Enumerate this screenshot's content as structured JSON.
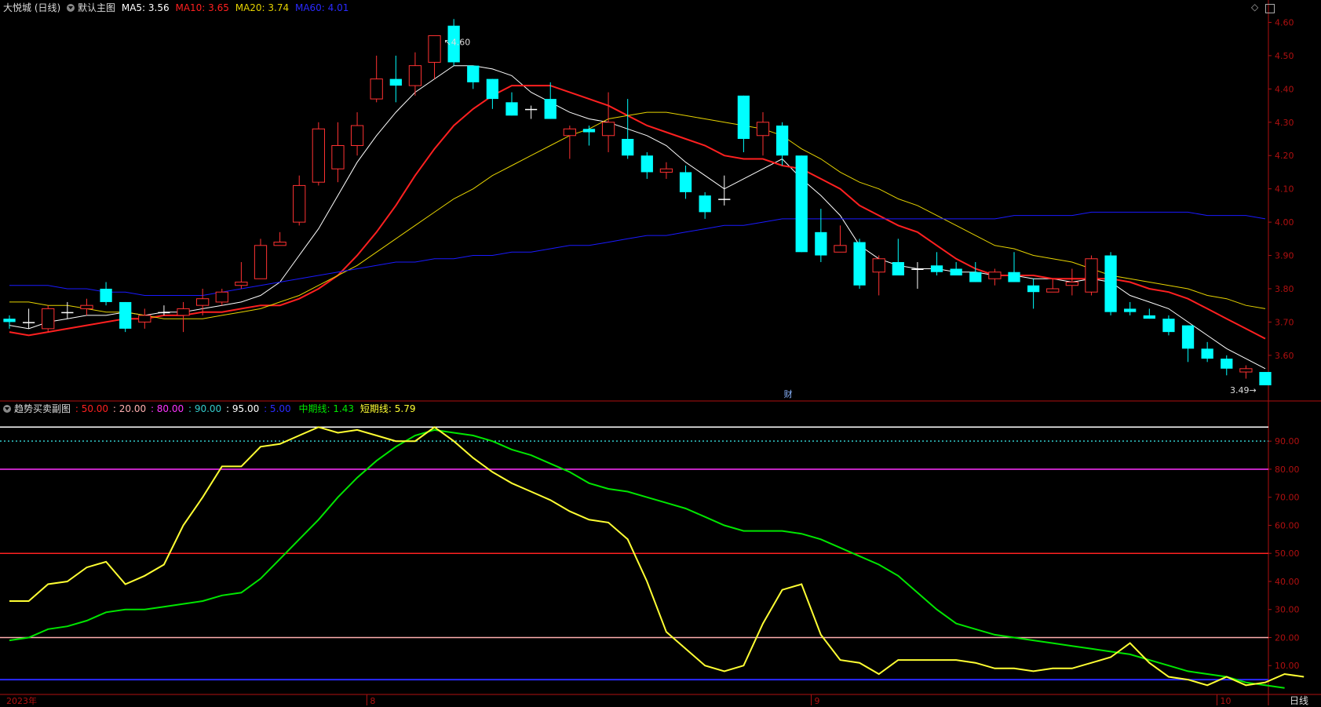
{
  "header": {
    "stock_name": "大悦城 (日线)",
    "main_chart_label": "默认主图",
    "ma5": "MA5: 3.56",
    "ma10": "MA10: 3.65",
    "ma20": "MA20: 3.74",
    "ma60": "MA60: 4.01"
  },
  "sub_header": {
    "title": "趋势买卖副图",
    "levels": [
      ": 50.00",
      ": 20.00",
      ": 80.00",
      ": 90.00",
      ": 95.00",
      ": 5.00"
    ],
    "mid_line": "中期线: 1.43",
    "short_line": "短期线: 5.79"
  },
  "colors": {
    "up": "#ff3232",
    "down": "#00ffff",
    "ma5": "#ffffff",
    "ma10": "#ff2020",
    "ma20": "#e6d300",
    "ma60": "#1a1aff",
    "mid": "#00e600",
    "short": "#ffff33",
    "l50": "#ff2020",
    "l20": "#ffb0b0",
    "l80": "#ff33ff",
    "l90": "#33cccc",
    "l95": "#ffffff",
    "l5": "#2a2aff",
    "axis": "#b01010"
  },
  "bottom_bar": {
    "period_label": "日线"
  },
  "corner_icons": [
    "diamond-icon",
    "fullscreen-icon"
  ],
  "chart_data": [
    {
      "type": "candlestick",
      "title": "默认主图",
      "ylim": [
        3.47,
        4.62
      ],
      "y_ticks": [
        "4.60",
        "4.50",
        "4.40",
        "4.30",
        "4.20",
        "4.10",
        "4.00",
        "3.90",
        "3.80",
        "3.70",
        "3.60"
      ],
      "x_labels": [
        {
          "index": 0,
          "label": "2023年"
        },
        {
          "index": 19,
          "label": "8"
        },
        {
          "index": 42,
          "label": "9"
        },
        {
          "index": 63,
          "label": "10"
        }
      ],
      "annotations": {
        "high_label": "4.60",
        "high_index": 22,
        "low_label": "3.49",
        "low_index": 65,
        "event_label": "财",
        "event_index": 40
      },
      "ohlc": [
        [
          3.71,
          3.72,
          3.68,
          3.7
        ],
        [
          3.7,
          3.74,
          3.68,
          3.7
        ],
        [
          3.68,
          3.75,
          3.67,
          3.74
        ],
        [
          3.73,
          3.76,
          3.71,
          3.73
        ],
        [
          3.74,
          3.77,
          3.72,
          3.75
        ],
        [
          3.8,
          3.82,
          3.75,
          3.76
        ],
        [
          3.76,
          3.76,
          3.67,
          3.68
        ],
        [
          3.7,
          3.74,
          3.68,
          3.72
        ],
        [
          3.73,
          3.75,
          3.72,
          3.73
        ],
        [
          3.72,
          3.76,
          3.67,
          3.74
        ],
        [
          3.75,
          3.8,
          3.72,
          3.77
        ],
        [
          3.76,
          3.8,
          3.75,
          3.79
        ],
        [
          3.81,
          3.88,
          3.8,
          3.82
        ],
        [
          3.83,
          3.95,
          3.83,
          3.93
        ],
        [
          3.93,
          3.97,
          3.93,
          3.94
        ],
        [
          4.0,
          4.14,
          3.99,
          4.11
        ],
        [
          4.12,
          4.3,
          4.11,
          4.28
        ],
        [
          4.16,
          4.3,
          4.12,
          4.23
        ],
        [
          4.23,
          4.33,
          4.2,
          4.29
        ],
        [
          4.37,
          4.5,
          4.36,
          4.43
        ],
        [
          4.43,
          4.5,
          4.36,
          4.41
        ],
        [
          4.41,
          4.51,
          4.38,
          4.47
        ],
        [
          4.48,
          4.56,
          4.43,
          4.56
        ],
        [
          4.59,
          4.61,
          4.47,
          4.48
        ],
        [
          4.47,
          4.47,
          4.4,
          4.42
        ],
        [
          4.43,
          4.43,
          4.34,
          4.37
        ],
        [
          4.36,
          4.39,
          4.32,
          4.32
        ],
        [
          4.34,
          4.35,
          4.31,
          4.34
        ],
        [
          4.37,
          4.42,
          4.31,
          4.31
        ],
        [
          4.26,
          4.29,
          4.19,
          4.28
        ],
        [
          4.28,
          4.29,
          4.23,
          4.27
        ],
        [
          4.26,
          4.39,
          4.21,
          4.3
        ],
        [
          4.25,
          4.37,
          4.19,
          4.2
        ],
        [
          4.2,
          4.21,
          4.13,
          4.15
        ],
        [
          4.15,
          4.18,
          4.13,
          4.16
        ],
        [
          4.15,
          4.17,
          4.07,
          4.09
        ],
        [
          4.08,
          4.09,
          4.01,
          4.03
        ],
        [
          4.07,
          4.14,
          4.05,
          4.07
        ],
        [
          4.38,
          4.38,
          4.21,
          4.25
        ],
        [
          4.26,
          4.33,
          4.2,
          4.3
        ],
        [
          4.29,
          4.3,
          4.17,
          4.2
        ],
        [
          4.2,
          4.2,
          3.91,
          3.91
        ],
        [
          3.97,
          4.04,
          3.88,
          3.9
        ],
        [
          3.91,
          3.99,
          3.91,
          3.93
        ],
        [
          3.94,
          3.95,
          3.8,
          3.81
        ],
        [
          3.85,
          3.9,
          3.78,
          3.89
        ],
        [
          3.88,
          3.95,
          3.84,
          3.84
        ],
        [
          3.86,
          3.88,
          3.8,
          3.86
        ],
        [
          3.87,
          3.91,
          3.84,
          3.85
        ],
        [
          3.86,
          3.88,
          3.84,
          3.84
        ],
        [
          3.85,
          3.88,
          3.82,
          3.82
        ],
        [
          3.83,
          3.86,
          3.81,
          3.85
        ],
        [
          3.85,
          3.91,
          3.82,
          3.82
        ],
        [
          3.81,
          3.83,
          3.74,
          3.79
        ],
        [
          3.79,
          3.83,
          3.79,
          3.8
        ],
        [
          3.81,
          3.86,
          3.78,
          3.82
        ],
        [
          3.79,
          3.9,
          3.78,
          3.89
        ],
        [
          3.9,
          3.91,
          3.72,
          3.73
        ],
        [
          3.74,
          3.76,
          3.72,
          3.73
        ],
        [
          3.72,
          3.74,
          3.71,
          3.71
        ],
        [
          3.71,
          3.72,
          3.66,
          3.67
        ],
        [
          3.69,
          3.69,
          3.58,
          3.62
        ],
        [
          3.62,
          3.64,
          3.58,
          3.59
        ],
        [
          3.59,
          3.6,
          3.54,
          3.56
        ],
        [
          3.55,
          3.57,
          3.53,
          3.56
        ],
        [
          3.55,
          3.55,
          3.51,
          3.51
        ]
      ],
      "series": [
        {
          "name": "MA5",
          "values": [
            3.69,
            3.68,
            3.7,
            3.71,
            3.72,
            3.72,
            3.73,
            3.72,
            3.73,
            3.73,
            3.74,
            3.75,
            3.76,
            3.78,
            3.82,
            3.9,
            3.98,
            4.08,
            4.18,
            4.26,
            4.33,
            4.39,
            4.43,
            4.47,
            4.47,
            4.46,
            4.44,
            4.39,
            4.36,
            4.33,
            4.31,
            4.3,
            4.28,
            4.26,
            4.23,
            4.18,
            4.14,
            4.1,
            4.13,
            4.16,
            4.19,
            4.13,
            4.08,
            4.02,
            3.93,
            3.89,
            3.87,
            3.86,
            3.86,
            3.85,
            3.85,
            3.84,
            3.84,
            3.83,
            3.83,
            3.82,
            3.83,
            3.82,
            3.78,
            3.76,
            3.74,
            3.7,
            3.66,
            3.62,
            3.59,
            3.56
          ]
        },
        {
          "name": "MA10",
          "values": [
            3.67,
            3.66,
            3.67,
            3.68,
            3.69,
            3.7,
            3.71,
            3.71,
            3.72,
            3.72,
            3.73,
            3.73,
            3.74,
            3.75,
            3.75,
            3.77,
            3.8,
            3.84,
            3.9,
            3.97,
            4.05,
            4.14,
            4.22,
            4.29,
            4.34,
            4.38,
            4.41,
            4.41,
            4.41,
            4.39,
            4.37,
            4.35,
            4.32,
            4.29,
            4.27,
            4.25,
            4.23,
            4.2,
            4.19,
            4.19,
            4.17,
            4.16,
            4.13,
            4.1,
            4.05,
            4.02,
            3.99,
            3.97,
            3.93,
            3.89,
            3.86,
            3.84,
            3.84,
            3.84,
            3.83,
            3.83,
            3.83,
            3.83,
            3.82,
            3.8,
            3.79,
            3.77,
            3.74,
            3.71,
            3.68,
            3.65
          ]
        },
        {
          "name": "MA20",
          "values": [
            3.76,
            3.76,
            3.75,
            3.75,
            3.74,
            3.73,
            3.73,
            3.72,
            3.71,
            3.71,
            3.71,
            3.72,
            3.73,
            3.74,
            3.76,
            3.78,
            3.81,
            3.84,
            3.87,
            3.91,
            3.95,
            3.99,
            4.03,
            4.07,
            4.1,
            4.14,
            4.17,
            4.2,
            4.23,
            4.26,
            4.28,
            4.31,
            4.32,
            4.33,
            4.33,
            4.32,
            4.31,
            4.3,
            4.29,
            4.28,
            4.26,
            4.22,
            4.19,
            4.15,
            4.12,
            4.1,
            4.07,
            4.05,
            4.02,
            3.99,
            3.96,
            3.93,
            3.92,
            3.9,
            3.89,
            3.88,
            3.86,
            3.84,
            3.83,
            3.82,
            3.81,
            3.8,
            3.78,
            3.77,
            3.75,
            3.74
          ]
        },
        {
          "name": "MA60",
          "values": [
            3.81,
            3.81,
            3.81,
            3.8,
            3.8,
            3.79,
            3.79,
            3.78,
            3.78,
            3.78,
            3.78,
            3.79,
            3.8,
            3.81,
            3.82,
            3.83,
            3.84,
            3.85,
            3.86,
            3.87,
            3.88,
            3.88,
            3.89,
            3.89,
            3.9,
            3.9,
            3.91,
            3.91,
            3.92,
            3.93,
            3.93,
            3.94,
            3.95,
            3.96,
            3.96,
            3.97,
            3.98,
            3.99,
            3.99,
            4.0,
            4.01,
            4.01,
            4.01,
            4.01,
            4.01,
            4.01,
            4.01,
            4.01,
            4.01,
            4.01,
            4.01,
            4.01,
            4.02,
            4.02,
            4.02,
            4.02,
            4.03,
            4.03,
            4.03,
            4.03,
            4.03,
            4.03,
            4.02,
            4.02,
            4.02,
            4.01
          ]
        }
      ]
    },
    {
      "type": "line",
      "title": "趋势买卖副图",
      "ylim": [
        0,
        99
      ],
      "y_ticks": [
        "90.00",
        "80.00",
        "70.00",
        "60.00",
        "50.00",
        "40.00",
        "30.00",
        "20.00",
        "10.00"
      ],
      "levels": [
        {
          "value": 95,
          "style": "solid"
        },
        {
          "value": 90,
          "style": "dotted"
        },
        {
          "value": 80,
          "style": "solid"
        },
        {
          "value": 50,
          "style": "solid"
        },
        {
          "value": 20,
          "style": "solid"
        },
        {
          "value": 5,
          "style": "solid"
        }
      ],
      "series": [
        {
          "name": "中期线",
          "values": [
            19,
            20,
            23,
            24,
            26,
            29,
            30,
            30,
            31,
            32,
            33,
            35,
            36,
            41,
            48,
            55,
            62,
            70,
            77,
            83,
            88,
            92,
            94,
            93,
            92,
            90,
            87,
            85,
            82,
            79,
            75,
            73,
            72,
            70,
            68,
            66,
            63,
            60,
            58,
            58,
            58,
            57,
            55,
            52,
            49,
            46,
            42,
            36,
            30,
            25,
            23,
            21,
            20,
            19,
            18,
            17,
            16,
            15,
            14,
            12,
            10,
            8,
            7,
            6,
            4,
            3,
            2
          ]
        },
        {
          "name": "短期线",
          "values": [
            33,
            33,
            39,
            40,
            45,
            47,
            39,
            42,
            46,
            60,
            70,
            81,
            81,
            88,
            89,
            92,
            95,
            93,
            94,
            92,
            90,
            90,
            95,
            90,
            84,
            79,
            75,
            72,
            69,
            65,
            62,
            61,
            55,
            40,
            22,
            16,
            10,
            8,
            10,
            25,
            37,
            39,
            21,
            12,
            11,
            7,
            12,
            12,
            12,
            12,
            11,
            9,
            9,
            8,
            9,
            9,
            11,
            13,
            18,
            11,
            6,
            5,
            3,
            6,
            3,
            4,
            7,
            6
          ]
        }
      ]
    }
  ]
}
